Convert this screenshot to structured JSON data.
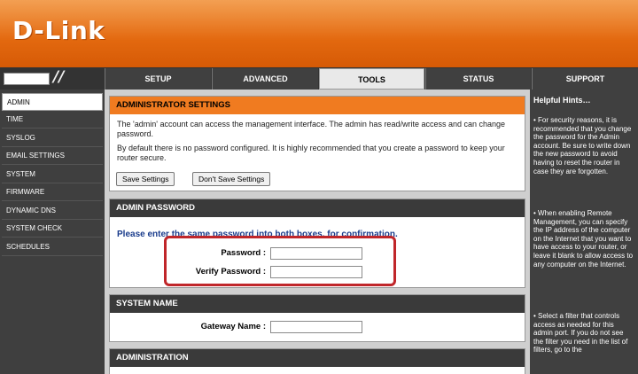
{
  "brand": {
    "logo": "D-Link"
  },
  "nav": {
    "tabs": [
      {
        "label": "SETUP"
      },
      {
        "label": "ADVANCED"
      },
      {
        "label": "TOOLS"
      },
      {
        "label": "STATUS"
      },
      {
        "label": "SUPPORT"
      }
    ],
    "active_tab": "TOOLS"
  },
  "sidebar": {
    "items": [
      {
        "label": "ADMIN"
      },
      {
        "label": "TIME"
      },
      {
        "label": "SYSLOG"
      },
      {
        "label": "EMAIL SETTINGS"
      },
      {
        "label": "SYSTEM"
      },
      {
        "label": "FIRMWARE"
      },
      {
        "label": "DYNAMIC DNS"
      },
      {
        "label": "SYSTEM CHECK"
      },
      {
        "label": "SCHEDULES"
      }
    ],
    "active_item": "ADMIN"
  },
  "admin_settings": {
    "title": "ADMINISTRATOR SETTINGS",
    "desc1": "The 'admin' account can access the management interface. The admin has read/write access and can change password.",
    "desc2": "By default there is no password configured. It is highly recommended that you create a password to keep your router secure.",
    "save_label": "Save Settings",
    "dont_save_label": "Don't Save Settings"
  },
  "admin_password": {
    "title": "ADMIN PASSWORD",
    "instruction": "Please enter the same password into both boxes, for confirmation.",
    "password_label": "Password :",
    "password_value": "",
    "verify_label": "Verify Password :",
    "verify_value": ""
  },
  "system_name": {
    "title": "SYSTEM NAME",
    "gateway_label": "Gateway Name :",
    "gateway_value": ""
  },
  "administration": {
    "title": "ADMINISTRATION"
  },
  "hints": {
    "title": "Helpful Hints…",
    "items": [
      "• For security reasons, it is recommended that you change the password for the Admin account. Be sure to write down the new password to avoid having to reset the router in case they are forgotten.",
      "• When enabling Remote Management, you can specify the IP address of the computer on the Internet that you want to have access to your router, or leave it blank to allow access to any computer on the Internet.",
      "• Select a filter that controls access as needed for this admin port. If you do not see the filter you need in the list of filters, go to the"
    ]
  },
  "colors": {
    "header_orange": "#e46a10",
    "section_orange": "#f07b20",
    "instruction_blue": "#1a3c8c",
    "highlight_red": "#c0262a"
  }
}
